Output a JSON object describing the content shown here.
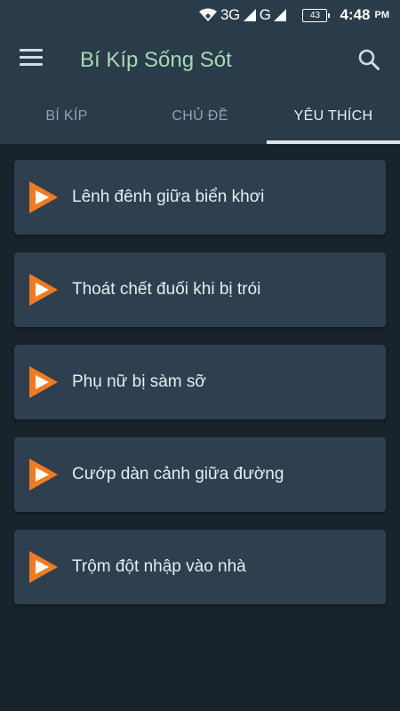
{
  "status_bar": {
    "network": "3G",
    "network2": "G",
    "battery": "43",
    "time": "4:48",
    "ampm": "PM"
  },
  "app_bar": {
    "title": "Bí Kíp Sống Sót",
    "icons": [
      "menu-icon",
      "search-icon"
    ]
  },
  "tabs": [
    {
      "label": "BÍ KÍP",
      "active": false
    },
    {
      "label": "CHỦ ĐỀ",
      "active": false
    },
    {
      "label": "YÊU THÍCH",
      "active": true
    }
  ],
  "favorites": [
    {
      "label": "Lênh đênh giữa biển khơi"
    },
    {
      "label": "Thoát chết đuối khi bị trói"
    },
    {
      "label": "Phụ nữ bị sàm sỡ"
    },
    {
      "label": "Cướp dàn cảnh giữa đường"
    },
    {
      "label": "Trộm đột nhập vào nhà"
    }
  ],
  "colors": {
    "app_bar": "#2a3b4a",
    "background": "#18232c",
    "card": "#2e4050",
    "title": "#a7d9b2",
    "play_orange": "#f47a1f"
  }
}
